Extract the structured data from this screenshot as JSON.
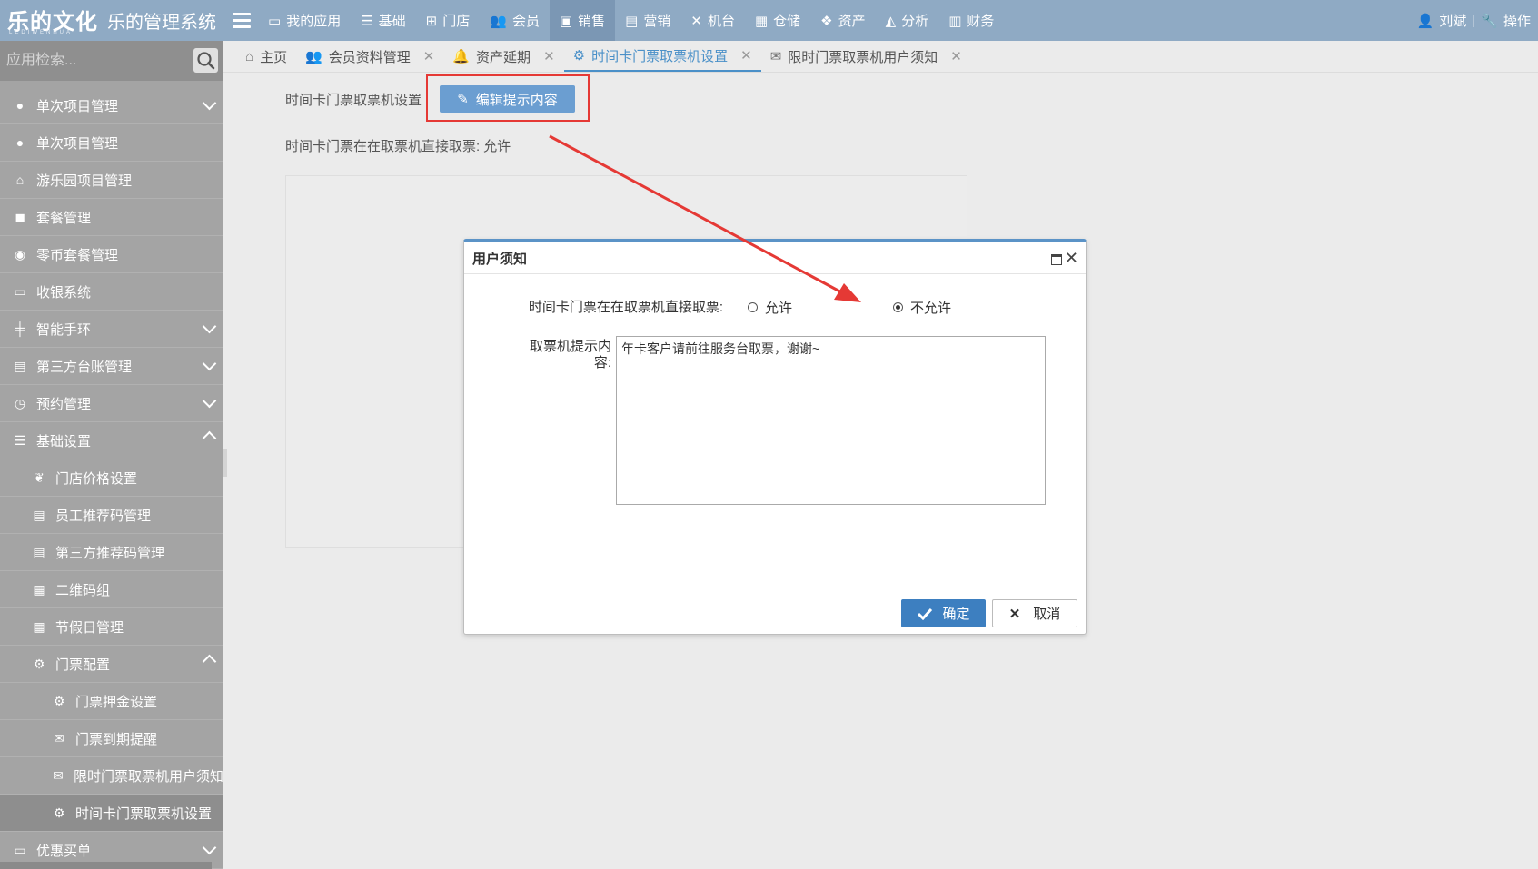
{
  "header": {
    "logo_text": "乐的文化",
    "logo_sub": "LEDIWENHUA",
    "system_title": "乐的管理系统",
    "nav": [
      {
        "label": "我的应用",
        "icon": "monitor-icon"
      },
      {
        "label": "基础",
        "icon": "database-icon"
      },
      {
        "label": "门店",
        "icon": "sitemap-icon"
      },
      {
        "label": "会员",
        "icon": "users-icon"
      },
      {
        "label": "销售",
        "icon": "briefcase-icon",
        "active": true
      },
      {
        "label": "营销",
        "icon": "presentation-icon"
      },
      {
        "label": "机台",
        "icon": "joystick-icon"
      },
      {
        "label": "仓储",
        "icon": "archive-icon"
      },
      {
        "label": "资产",
        "icon": "cubes-icon"
      },
      {
        "label": "分析",
        "icon": "area-chart-icon"
      },
      {
        "label": "财务",
        "icon": "calculator-icon"
      }
    ],
    "user_name": "刘斌",
    "separator": "|",
    "operation_label": "操作"
  },
  "sidebar": {
    "search_placeholder": "应用检索...",
    "items": [
      {
        "label": "单次项目管理",
        "level": 1,
        "arrow": "down",
        "icon": "gamepad-icon"
      },
      {
        "label": "单次项目管理",
        "level": 1,
        "icon": "gamepad-icon"
      },
      {
        "label": "游乐园项目管理",
        "level": 1,
        "icon": "carousel-icon"
      },
      {
        "label": "套餐管理",
        "level": 1,
        "icon": "shopping-bag-icon"
      },
      {
        "label": "零币套餐管理",
        "level": 1,
        "icon": "coin-icon"
      },
      {
        "label": "收银系统",
        "level": 1,
        "icon": "laptop-icon"
      },
      {
        "label": "智能手环",
        "level": 1,
        "arrow": "down",
        "icon": "wristband-icon"
      },
      {
        "label": "第三方台账管理",
        "level": 1,
        "arrow": "down",
        "icon": "ledger-icon"
      },
      {
        "label": "预约管理",
        "level": 1,
        "arrow": "down",
        "icon": "clock-icon"
      },
      {
        "label": "基础设置",
        "level": 1,
        "arrow": "up",
        "icon": "database-icon"
      },
      {
        "label": "门店价格设置",
        "level": 2,
        "icon": "leaf-icon"
      },
      {
        "label": "员工推荐码管理",
        "level": 2,
        "icon": "list-icon"
      },
      {
        "label": "第三方推荐码管理",
        "level": 2,
        "icon": "list-icon"
      },
      {
        "label": "二维码组",
        "level": 2,
        "icon": "qrcode-icon"
      },
      {
        "label": "节假日管理",
        "level": 2,
        "icon": "calendar-icon"
      },
      {
        "label": "门票配置",
        "level": 2,
        "arrow": "up",
        "icon": "gear-icon"
      },
      {
        "label": "门票押金设置",
        "level": 3,
        "icon": "gear-icon"
      },
      {
        "label": "门票到期提醒",
        "level": 3,
        "icon": "envelope-icon"
      },
      {
        "label": "限时门票取票机用户须知",
        "level": 3,
        "icon": "envelope-icon"
      },
      {
        "label": "时间卡门票取票机设置",
        "level": 3,
        "icon": "gear-icon",
        "selected": true
      },
      {
        "label": "优惠买单",
        "level": 1,
        "arrow": "down",
        "icon": "voucher-icon"
      }
    ]
  },
  "tabs": [
    {
      "label": "主页",
      "icon": "home-icon",
      "closable": false
    },
    {
      "label": "会员资料管理",
      "icon": "users-icon",
      "closable": true
    },
    {
      "label": "资产延期",
      "icon": "bell-icon",
      "closable": true
    },
    {
      "label": "时间卡门票取票机设置",
      "icon": "gear-icon",
      "closable": true,
      "active": true
    },
    {
      "label": "限时门票取票机用户须知",
      "icon": "envelope-icon",
      "closable": true
    }
  ],
  "content": {
    "section_label": "时间卡门票取票机设置",
    "edit_button": "编辑提示内容",
    "status_label": "时间卡门票在在取票机直接取票:",
    "status_value": "允许"
  },
  "dialog": {
    "title": "用户须知",
    "option_label": "时间卡门票在在取票机直接取票:",
    "options": [
      {
        "label": "允许",
        "checked": false
      },
      {
        "label": "不允许",
        "checked": true
      }
    ],
    "prompt_label_line1": "取票机提示内",
    "prompt_label_line2": "容:",
    "prompt_value": "年卡客户请前往服务台取票，谢谢~",
    "ok_label": "确定",
    "cancel_label": "取消"
  },
  "colors": {
    "topbar": "#8faac4",
    "sidebar": "#a4a4a4",
    "accent": "#4a90c8",
    "primary_button": "#3d7fc0",
    "annotation_red": "#e53935"
  }
}
